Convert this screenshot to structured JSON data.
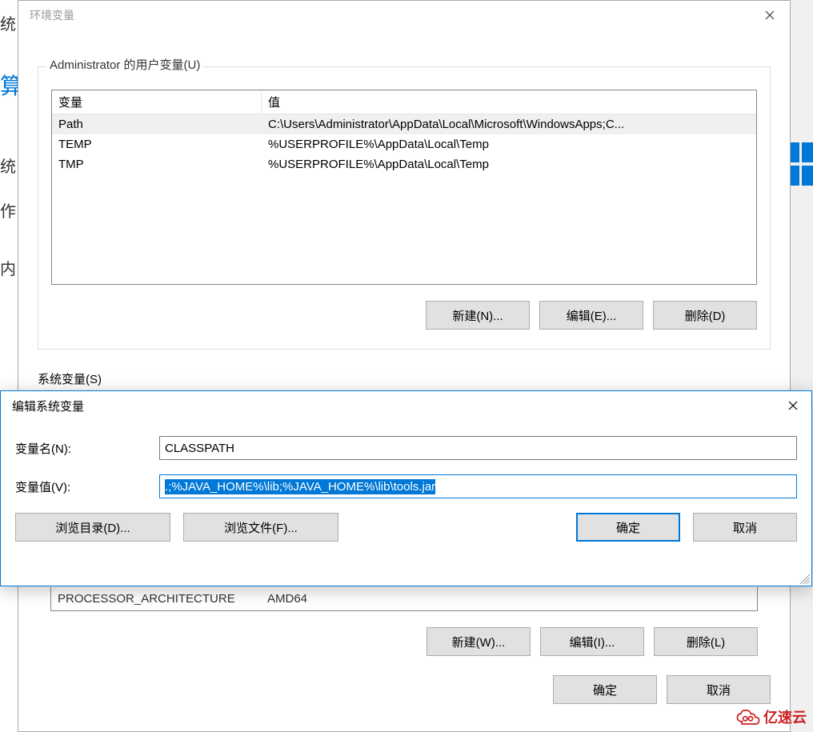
{
  "bg": {
    "char1": "统",
    "char2": "算",
    "char3": "统",
    "char4": "作",
    "char5": "内"
  },
  "envDialog": {
    "title": "环境变量",
    "userGroupLabel": "Administrator 的用户变量(U)",
    "systemGroupLabel": "系统变量(S)",
    "columns": {
      "name": "变量",
      "value": "值"
    },
    "userVars": [
      {
        "name": "Path",
        "value": "C:\\Users\\Administrator\\AppData\\Local\\Microsoft\\WindowsApps;C..."
      },
      {
        "name": "TEMP",
        "value": "%USERPROFILE%\\AppData\\Local\\Temp"
      },
      {
        "name": "TMP",
        "value": "%USERPROFILE%\\AppData\\Local\\Temp"
      }
    ],
    "sysPeek": {
      "name": "PROCESSOR_ARCHITECTURE",
      "value": "AMD64"
    },
    "buttons": {
      "newUser": "新建(N)...",
      "editUser": "编辑(E)...",
      "deleteUser": "删除(D)",
      "newSys": "新建(W)...",
      "editSys": "编辑(I)...",
      "deleteSys": "删除(L)",
      "ok": "确定",
      "cancel": "取消"
    }
  },
  "editDialog": {
    "title": "编辑系统变量",
    "nameLabel": "变量名(N):",
    "valueLabel": "变量值(V):",
    "nameValue": "CLASSPATH",
    "valueValue": ".;%JAVA_HOME%\\lib;%JAVA_HOME%\\lib\\tools.jar",
    "buttons": {
      "browseDir": "浏览目录(D)...",
      "browseFile": "浏览文件(F)...",
      "ok": "确定",
      "cancel": "取消"
    }
  },
  "watermark": "亿速云"
}
